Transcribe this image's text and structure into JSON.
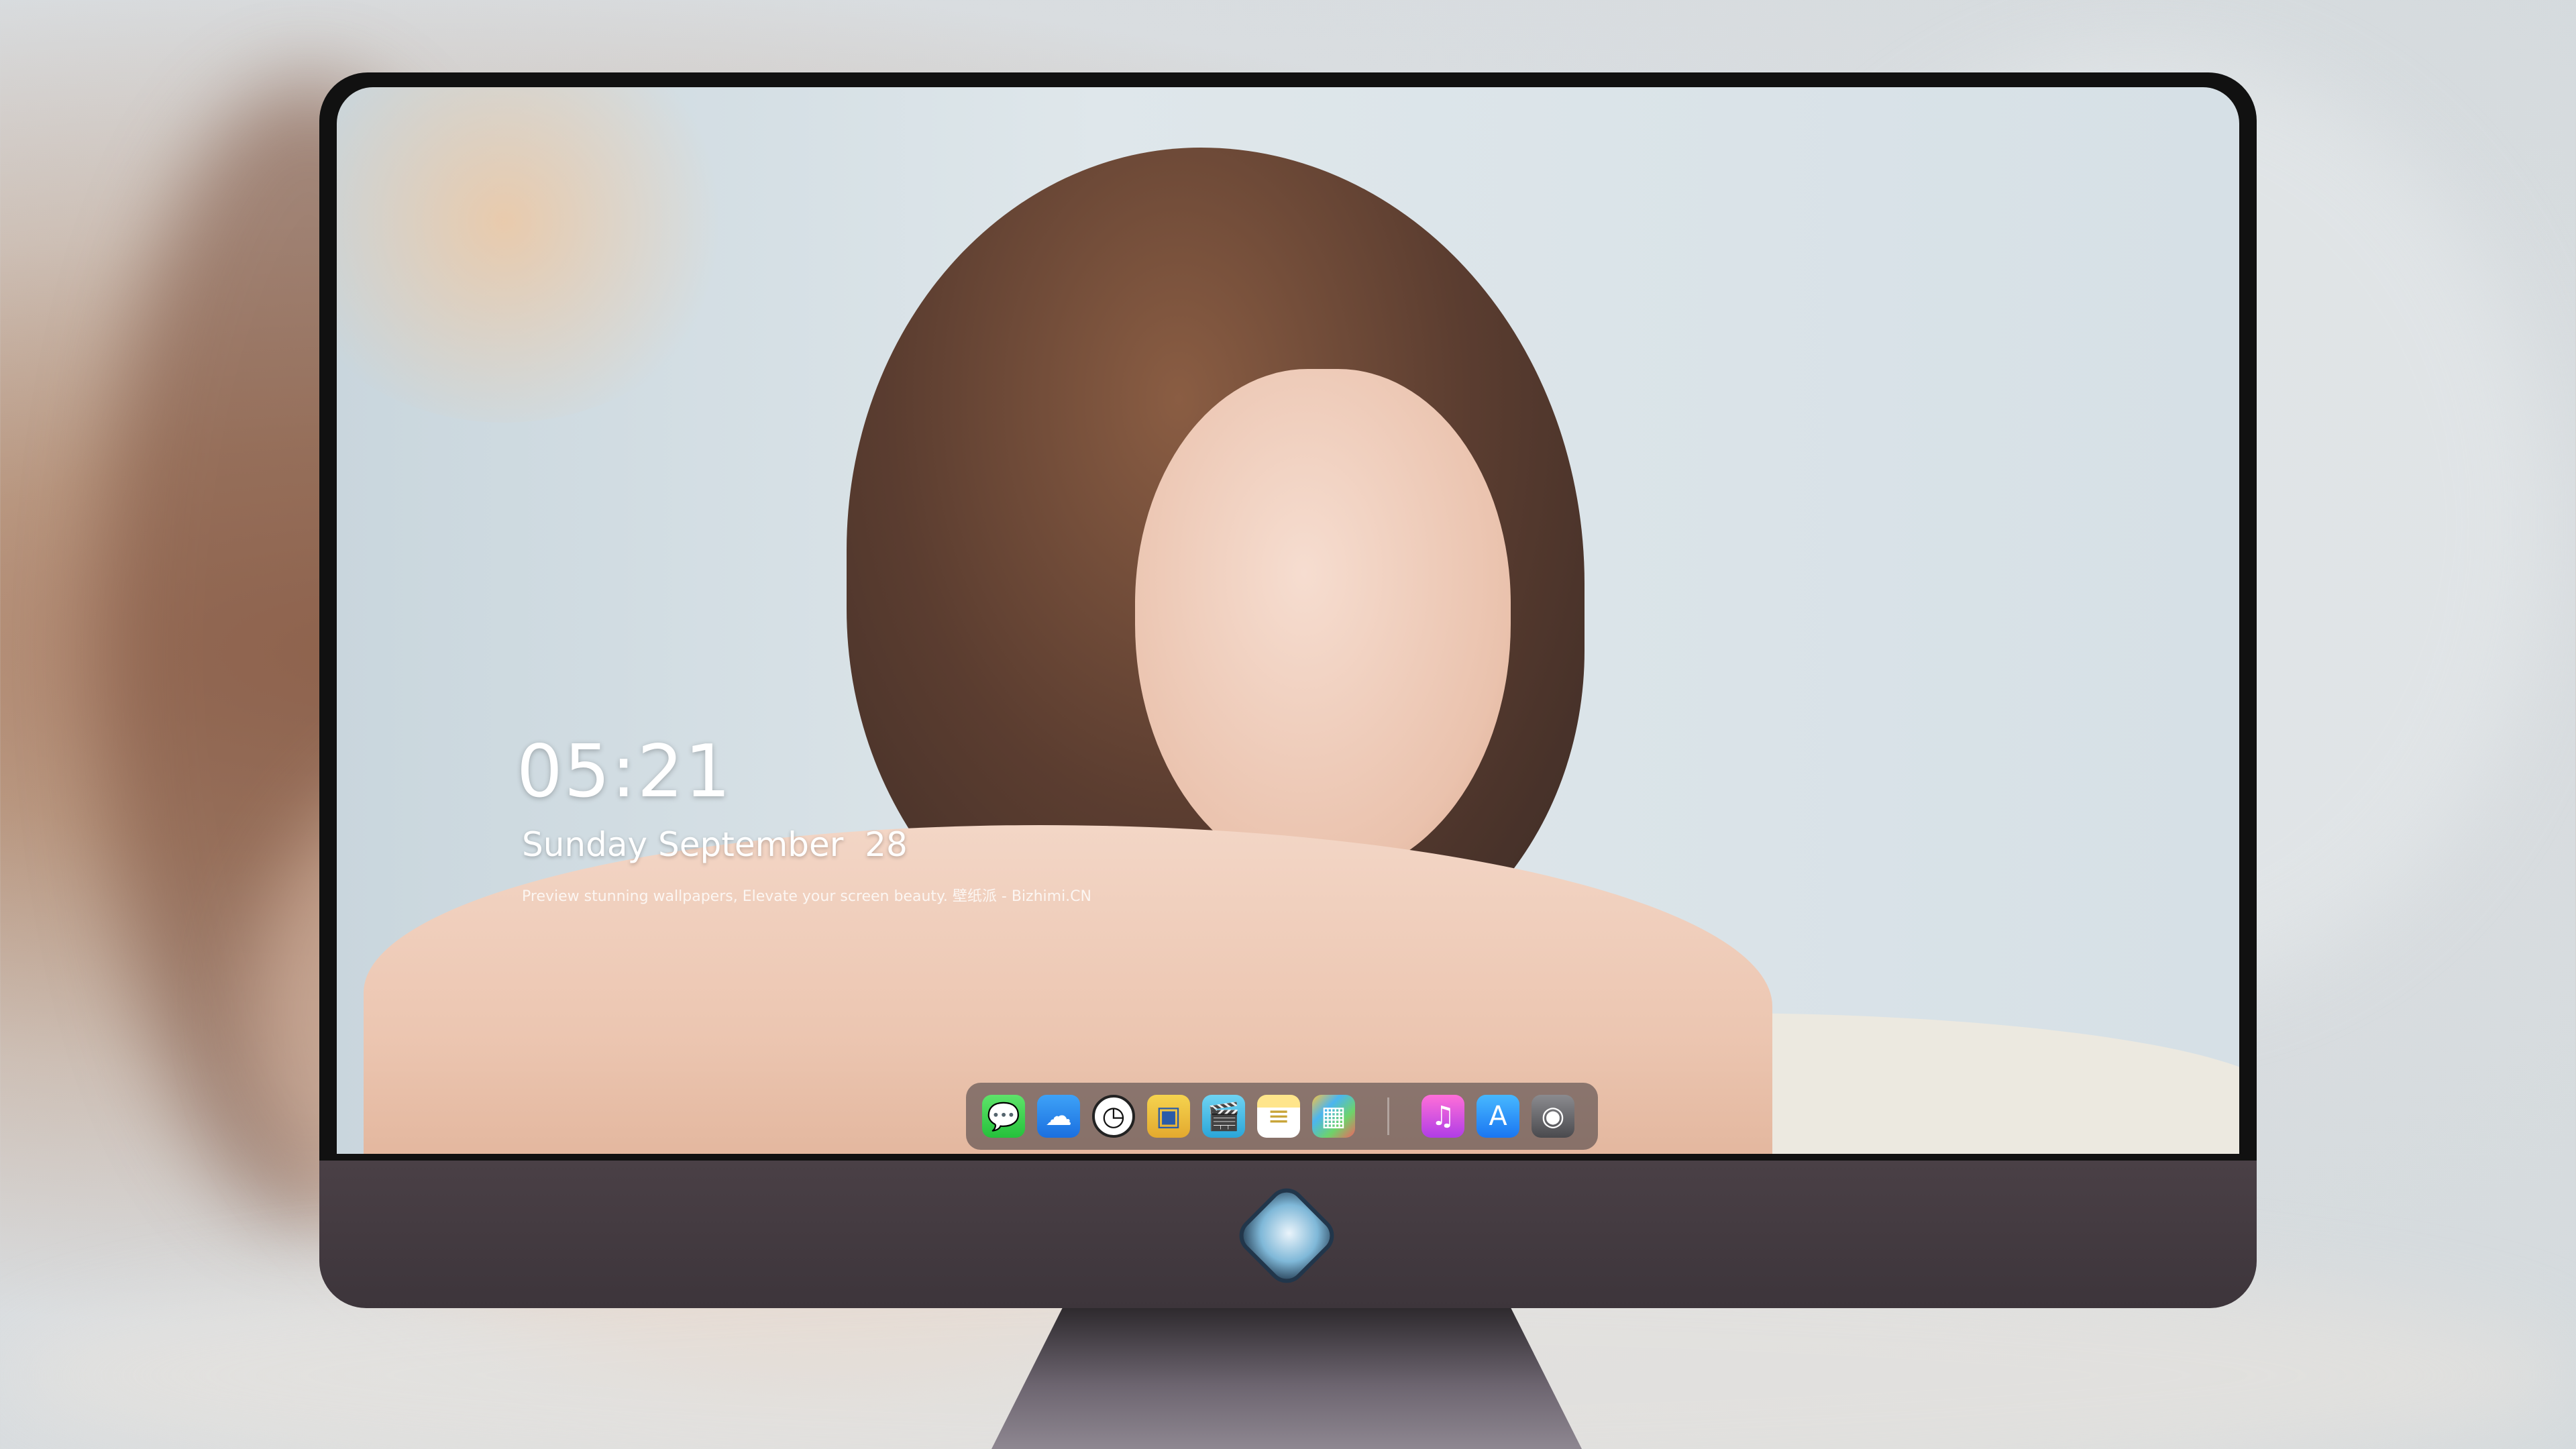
{
  "lock_screen": {
    "time": "05:21",
    "date": "Sunday September  28",
    "tagline": "Preview stunning wallpapers, Elevate your screen beauty. 壁纸派 - Bizhimi.CN"
  },
  "dock": {
    "apps": [
      {
        "name": "Messages",
        "icon": "message-bubble-icon",
        "glyph": "💬"
      },
      {
        "name": "Weather",
        "icon": "weather-cloud-icon",
        "glyph": "☁"
      },
      {
        "name": "Clock",
        "icon": "clock-icon",
        "glyph": "◷"
      },
      {
        "name": "Preview",
        "icon": "preview-icon",
        "glyph": "▣"
      },
      {
        "name": "Clips",
        "icon": "clapper-icon",
        "glyph": "🎬"
      },
      {
        "name": "Notes",
        "icon": "notes-icon",
        "glyph": "≡"
      },
      {
        "name": "Photos",
        "icon": "photos-icon",
        "glyph": "▦"
      },
      {
        "name": "Music",
        "icon": "music-note-icon",
        "glyph": "♫"
      },
      {
        "name": "App Store",
        "icon": "app-store-icon",
        "glyph": "A"
      },
      {
        "name": "Camera",
        "icon": "camera-icon",
        "glyph": "◉"
      }
    ]
  },
  "colors": {
    "dock_background": "#3c373c",
    "monitor_chin": "#4a4046",
    "text": "#ffffff"
  }
}
